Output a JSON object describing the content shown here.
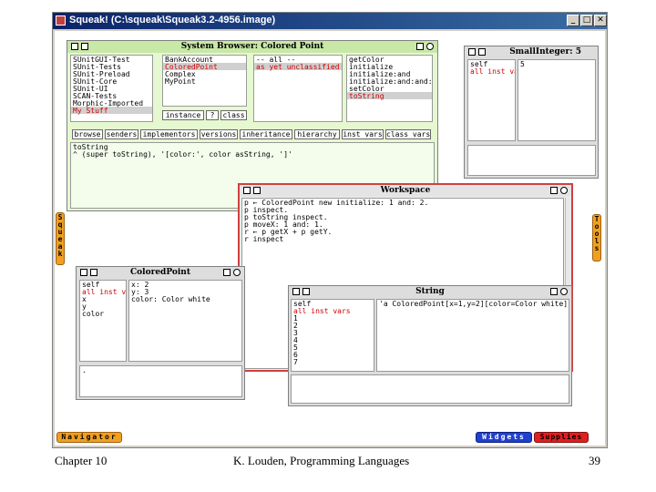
{
  "window": {
    "title": "Squeak! (C:\\squeak\\Squeak3.2-4956.image)",
    "buttons": {
      "minimize": "_",
      "maximize": "□",
      "close": "✕"
    }
  },
  "browser": {
    "title": "System Browser: Colored Point",
    "categories": [
      "SUnitGUI-Test",
      "SUnit-Tests",
      "SUnit-Preload",
      "SUnit-Core",
      "SUnit-UI",
      "SCAN-Tests",
      "Morphic-Imported",
      "My Stuff"
    ],
    "classes": [
      "BankAccount",
      "ColoredPoint",
      "Complex",
      "MyPoint"
    ],
    "protocols": [
      "-- all --",
      "as yet unclassified"
    ],
    "methods": [
      "getColor",
      "initialize",
      "initialize:and",
      "initialize:and:and:",
      "setColor",
      "toString"
    ],
    "switches": [
      "instance",
      "?",
      "class"
    ],
    "toolbar": [
      "browse",
      "senders",
      "implementors",
      "versions",
      "inheritance",
      "hierarchy",
      "inst vars",
      "class vars"
    ],
    "code": [
      "toString",
      "  ^ (super toString), '[color:', color asString, ']'"
    ]
  },
  "smallinteger": {
    "title": "SmallInteger: 5",
    "fields": [
      "self",
      "all inst vars"
    ],
    "value": "5"
  },
  "workspace": {
    "title": "Workspace",
    "lines": [
      "p ← ColoredPoint new initialize: 1 and: 2.",
      "p inspect.",
      "p toString inspect.",
      "p moveX: 1 and: 1.",
      "r ← p getX + p getY.",
      "r inspect"
    ]
  },
  "coloredpoint_inspector": {
    "title": "ColoredPoint",
    "fields": [
      "self",
      "all inst vars",
      "x",
      "y",
      "color"
    ],
    "values": [
      "x:    2",
      "y:    3",
      "color:   Color white"
    ],
    "bottom": "."
  },
  "string_inspector": {
    "title": "String",
    "fields": [
      "self",
      "all inst vars",
      "1",
      "2",
      "3",
      "4",
      "5",
      "6",
      "7"
    ],
    "value": "'a ColoredPoint[x=1,y=2][color=Color white]'"
  },
  "flaps": {
    "squeak": "Squeak",
    "tools": "Tools",
    "navigator": "Navigator",
    "widgets": "Widgets",
    "supplies": "Supplies"
  },
  "footer": {
    "left": "Chapter 10",
    "center": "K. Louden, Programming Languages",
    "right": "39"
  },
  "colors": {
    "browser_bg": "#e6f8d0",
    "browser_head": "#c8e8a8",
    "workspace_border": "#d04040",
    "inspector_bg": "#dddddd",
    "flap_orange": "#f0a020",
    "flap_blue": "#2040d0",
    "flap_red": "#e02020"
  }
}
